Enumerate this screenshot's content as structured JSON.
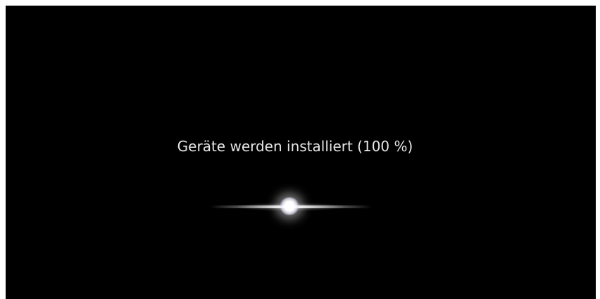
{
  "setup": {
    "status_message": "Geräte werden installiert (100 %)",
    "progress_percent": 100
  },
  "colors": {
    "background": "#000000",
    "text": "#e6e6e6",
    "glow": "#ffffff"
  },
  "icons": {
    "loading_indicator": "glowing-orb-spinner-icon"
  }
}
